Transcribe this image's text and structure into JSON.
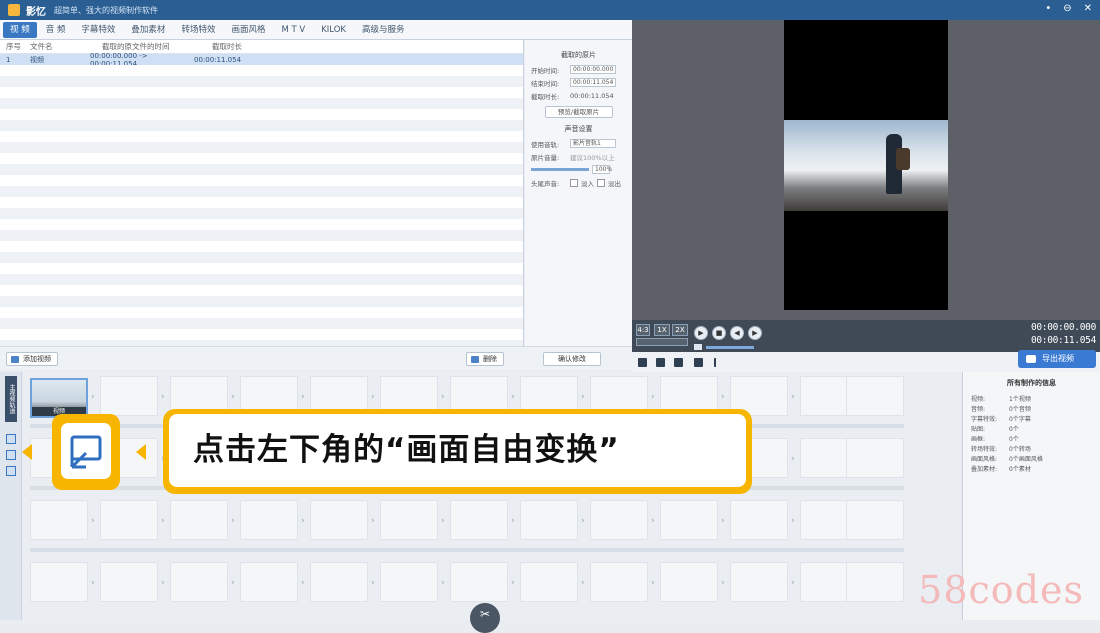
{
  "app": {
    "name": "影忆",
    "tagline": "超简单、强大的视频制作软件"
  },
  "window_controls": [
    "•",
    "⊖",
    "✕"
  ],
  "tabs": [
    "视 频",
    "音 频",
    "字幕特效",
    "叠加素材",
    "转场特效",
    "画面风格",
    "M T V",
    "KILOK",
    "高级与服务"
  ],
  "clip_list": {
    "columns": [
      "序号",
      "文件名",
      "截取的原文件的时间",
      "截取时长"
    ],
    "rows": [
      [
        "1",
        "视频",
        "00:00:00.000 -> 00:00:11.054",
        "00:00:11.054"
      ]
    ]
  },
  "props": {
    "section1": "截取的原片",
    "start_label": "开始时间:",
    "start_value": "00:00:00.000",
    "end_label": "结束时间:",
    "end_value": "00:00:11.054",
    "duration_label": "截取时长:",
    "duration_value": "00:00:11.054",
    "pick_btn": "预览/截取原片",
    "section2": "声音设置",
    "track_label": "使用音轨:",
    "track_value": "影片音轨1",
    "volume_label": "原片音量:",
    "volume_hint": "建议100%以上",
    "volume_pct": "100%",
    "fade_label": "头尾声音:",
    "fade_in": "淡入",
    "fade_out": "淡出",
    "confirm_btn": "确认修改"
  },
  "bottom": {
    "add_btn": "添加视频",
    "delete_btn": "删除"
  },
  "player": {
    "ratio": "4:3",
    "speed1": "1X",
    "speed2": "2X",
    "time_current": "00:00:00.000",
    "time_total": "00:00:11.054",
    "export_btn": "导出视频"
  },
  "timeline": {
    "side_label": "主视频轨道",
    "clip_label": "视频"
  },
  "info": {
    "title": "所有制作的信息",
    "rows": [
      [
        "视频:",
        "1个视频"
      ],
      [
        "音频:",
        "0个音频"
      ],
      [
        "字幕特效:",
        "0个字幕"
      ],
      [
        "贴图:",
        "0个"
      ],
      [
        "画框:",
        "0个"
      ],
      [
        "转场特效:",
        "0个转场"
      ],
      [
        "画面风格:",
        "0个画面风格"
      ],
      [
        "叠加素材:",
        "0个素材"
      ]
    ]
  },
  "callout": {
    "text": "点击左下角的“画面自由变换”"
  },
  "watermark": "58codes"
}
